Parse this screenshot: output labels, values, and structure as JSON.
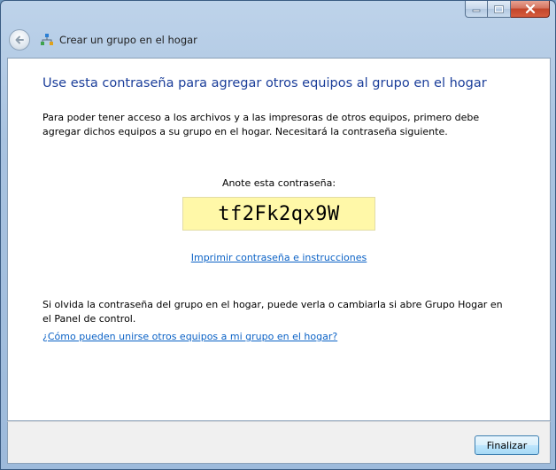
{
  "window": {
    "title": "Crear un grupo en el hogar",
    "controls": {
      "minimize": "minimize-icon",
      "maximize": "maximize-icon",
      "close": "close-icon"
    }
  },
  "page": {
    "heading": "Use esta contraseña para agregar otros equipos al grupo en el hogar",
    "intro": "Para poder tener acceso a los archivos y a las impresoras de otros equipos, primero debe agregar dichos equipos a su grupo en el hogar. Necesitará la contraseña siguiente.",
    "password_label": "Anote esta contraseña:",
    "password": "tf2Fk2qx9W",
    "print_link": "Imprimir contraseña e instrucciones",
    "note": "Si olvida la contraseña del grupo en el hogar, puede verla o cambiarla si abre Grupo Hogar en el Panel de control.",
    "help_link": "¿Cómo pueden unirse otros equipos a mi grupo en el hogar?"
  },
  "footer": {
    "finish_label": "Finalizar"
  },
  "colors": {
    "heading": "#1b3e9a",
    "link": "#0b62c6",
    "password_bg": "#fff8a8"
  }
}
